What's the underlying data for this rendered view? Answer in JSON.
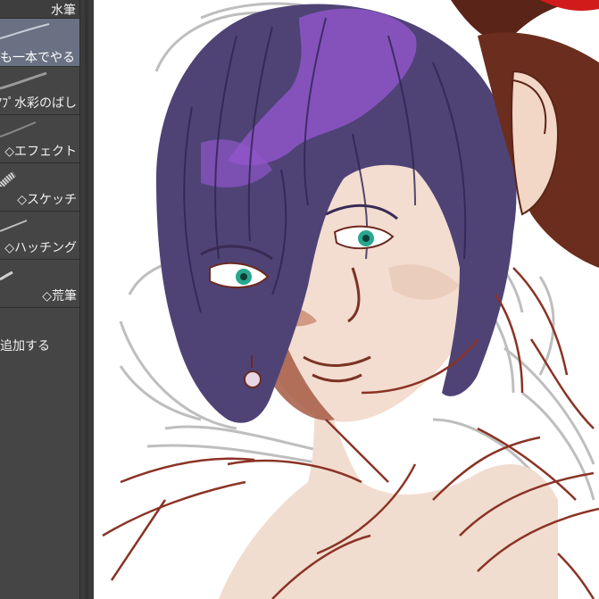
{
  "brush_panel": {
    "group_title": "水筆",
    "items": [
      {
        "label": "も一本でやる",
        "selected": true
      },
      {
        "label": "ｱﾌﾟ水彩のばし",
        "selected": false
      },
      {
        "label": "◇エフェクト",
        "selected": false
      },
      {
        "label": "◇スケッチ",
        "selected": false
      },
      {
        "label": "◇ハッチング",
        "selected": false
      },
      {
        "label": "◇荒筆",
        "selected": false
      }
    ],
    "add_label": "追加する"
  },
  "colors": {
    "panel_bg": "#454545",
    "selected_bg": "#6a7183",
    "hair": "#4f4376",
    "hair_highlight": "#8e55c9",
    "skin": "#f2dccf",
    "skin_shadow": "#a0654e",
    "lineart": "#8a3325",
    "sketch": "#b8b8b8",
    "eye": "#27a88e",
    "bg_hair": "#5a2518"
  }
}
